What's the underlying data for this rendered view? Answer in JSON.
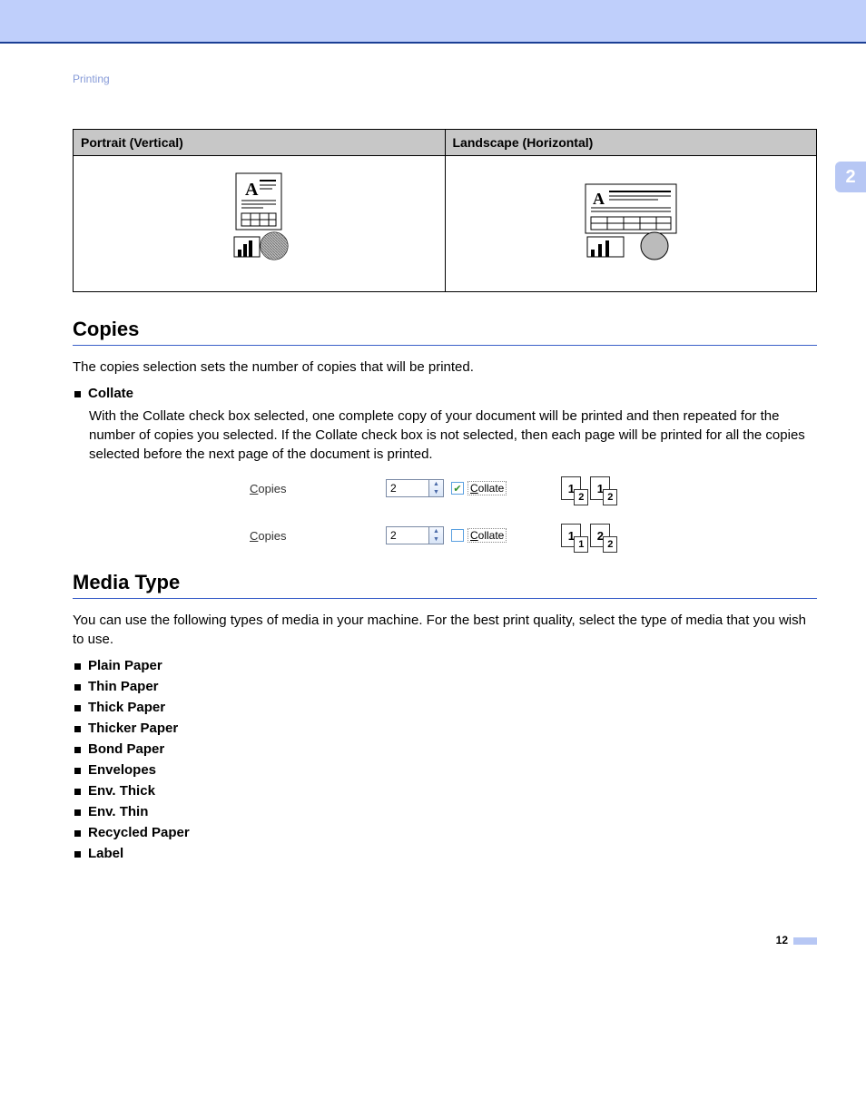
{
  "breadcrumb": "Printing",
  "chapter_tab": "2",
  "orientation": {
    "portrait_header": "Portrait (Vertical)",
    "landscape_header": "Landscape (Horizontal)"
  },
  "copies": {
    "heading": "Copies",
    "intro": "The copies selection sets the number of copies that will be printed.",
    "collate_label": "Collate",
    "collate_desc": "With the Collate check box selected, one complete copy of your document will be printed and then repeated for the number of copies you selected. If the Collate check box is not selected, then each page will be printed for all the copies selected before the next page of the document is printed.",
    "row_label_prefix": "C",
    "row_label_rest": "opies",
    "spin_value": "2",
    "checkbox_prefix": "C",
    "checkbox_rest": "ollate",
    "preview_checked": {
      "a_main": "1",
      "a_sub": "2",
      "b_main": "1",
      "b_sub": "2"
    },
    "preview_unchecked": {
      "a_main": "1",
      "a_sub": "1",
      "b_main": "2",
      "b_sub": "2"
    }
  },
  "media": {
    "heading": "Media Type",
    "intro": "You can use the following types of media in your machine. For the best print quality, select the type of media that you wish to use.",
    "items": [
      "Plain Paper",
      "Thin Paper",
      "Thick Paper",
      "Thicker Paper",
      "Bond Paper",
      "Envelopes",
      "Env. Thick",
      "Env. Thin",
      "Recycled Paper",
      "Label"
    ]
  },
  "page_number": "12"
}
